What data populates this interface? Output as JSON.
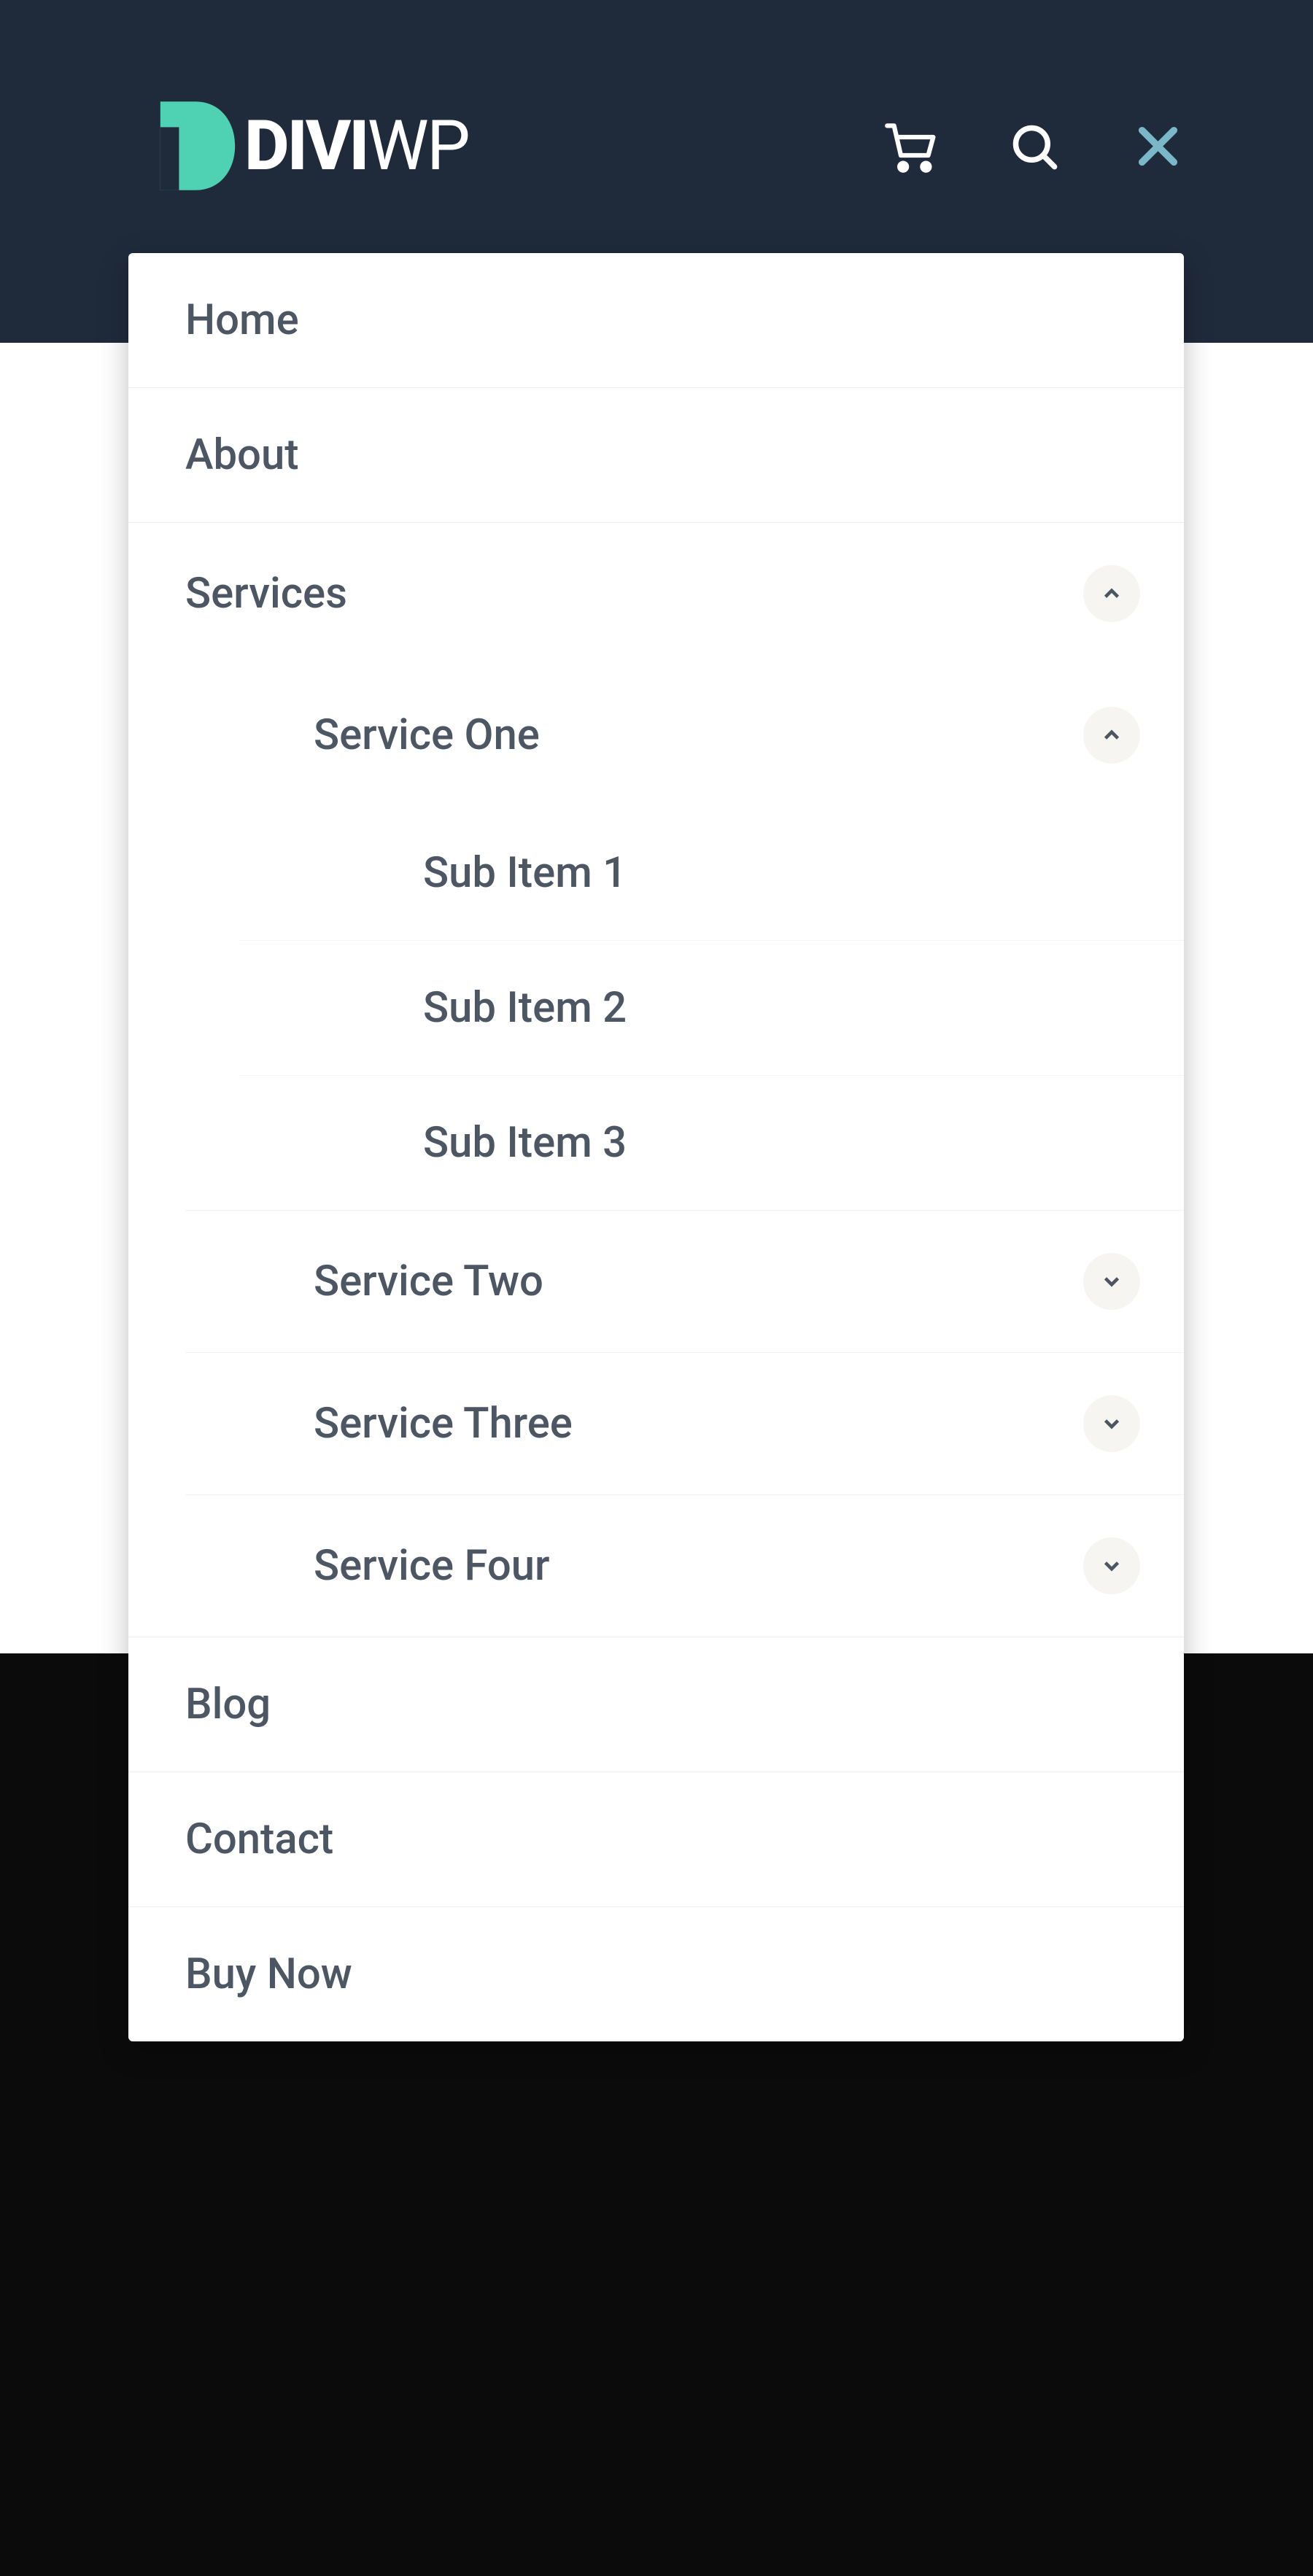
{
  "brand": {
    "name_primary": "DIVI",
    "name_secondary": "WP"
  },
  "menu": {
    "home": "Home",
    "about": "About",
    "services": {
      "label": "Services",
      "service_one": {
        "label": "Service One",
        "sub1": "Sub Item 1",
        "sub2": "Sub Item 2",
        "sub3": "Sub Item 3"
      },
      "service_two": "Service Two",
      "service_three": "Service Three",
      "service_four": "Service Four"
    },
    "blog": "Blog",
    "contact": "Contact",
    "buy_now": "Buy Now"
  },
  "colors": {
    "header_bg": "#1f2a3b",
    "accent_teal": "#4fd1b3",
    "close_icon": "#7ab8c9",
    "menu_text": "#4d5763",
    "divider": "#eceef0",
    "chevron_bg": "#f6f5f2"
  }
}
